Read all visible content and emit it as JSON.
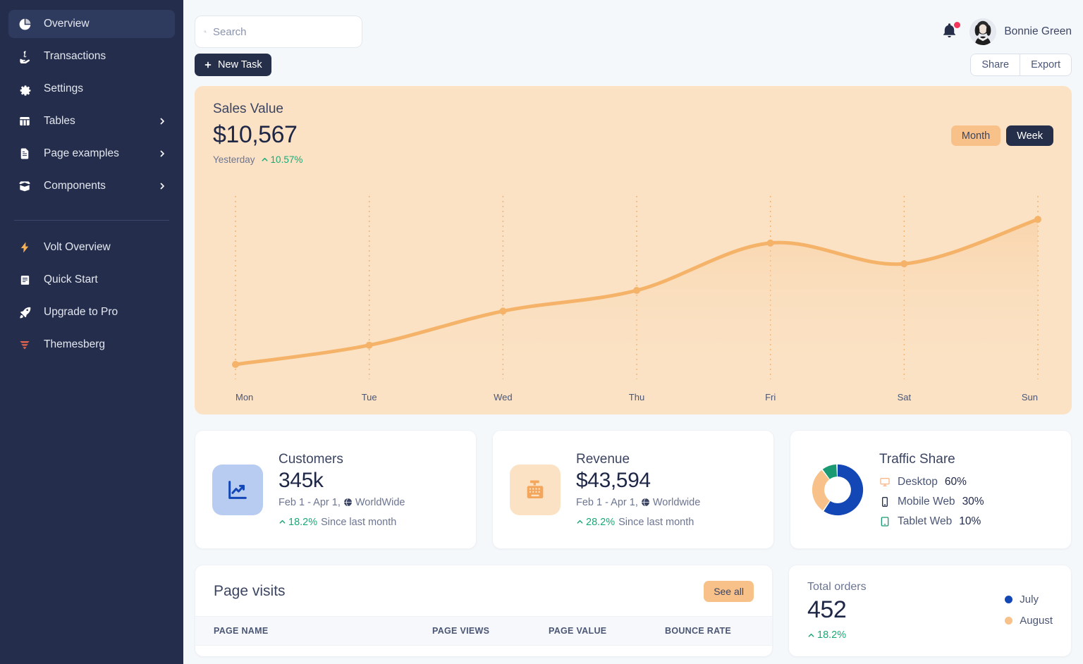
{
  "sidebar": {
    "items": [
      {
        "label": "Overview",
        "icon": "pie-chart-icon",
        "active": true,
        "chevron": false
      },
      {
        "label": "Transactions",
        "icon": "hand-dollar-icon",
        "active": false,
        "chevron": false
      },
      {
        "label": "Settings",
        "icon": "gear-icon",
        "active": false,
        "chevron": false
      },
      {
        "label": "Tables",
        "icon": "table-icon",
        "active": false,
        "chevron": true
      },
      {
        "label": "Page examples",
        "icon": "document-icon",
        "active": false,
        "chevron": true
      },
      {
        "label": "Components",
        "icon": "open-box-icon",
        "active": false,
        "chevron": true
      }
    ],
    "secondary": [
      {
        "label": "Volt Overview",
        "icon": "lightning-bolt-icon",
        "color": "#f8b155"
      },
      {
        "label": "Quick Start",
        "icon": "book-icon",
        "color": "#ffffff"
      },
      {
        "label": "Upgrade to Pro",
        "icon": "rocket-icon",
        "color": "#ffffff"
      },
      {
        "label": "Themesberg",
        "icon": "themesberg-logo-icon",
        "color": "#f0674f"
      }
    ]
  },
  "topbar": {
    "search_placeholder": "Search",
    "search_value": "",
    "notification_badge": true,
    "user_name": "Bonnie Green"
  },
  "actionbar": {
    "new_task_label": "New Task",
    "share_label": "Share",
    "export_label": "Export"
  },
  "sales": {
    "title": "Sales Value",
    "value": "$10,567",
    "period_label": "Yesterday",
    "change": "10.57%",
    "toggle_month": "Month",
    "toggle_week": "Week"
  },
  "chart_data": {
    "type": "line",
    "title": "Sales Value",
    "categories": [
      "Mon",
      "Tue",
      "Wed",
      "Thu",
      "Fri",
      "Sat",
      "Sun"
    ],
    "values": [
      10,
      23,
      46,
      60,
      92,
      78,
      108
    ],
    "xlabel": "",
    "ylabel": "",
    "ylim": [
      0,
      120
    ],
    "grid": "vertical-dotted",
    "legend": "none",
    "line_color": "#f5b36a",
    "fill_color": "#f9d6ab"
  },
  "stats": [
    {
      "name": "Customers",
      "value": "345k",
      "range": "Feb 1 - Apr 1,",
      "scope": "WorldWide",
      "delta": "18.2%",
      "delta_suffix": "Since last month",
      "icon": "chart-line-up-icon",
      "icon_style": "blue"
    },
    {
      "name": "Revenue",
      "value": "$43,594",
      "range": "Feb 1 - Apr 1,",
      "scope": "Worldwide",
      "delta": "28.2%",
      "delta_suffix": "Since last month",
      "icon": "cash-register-icon",
      "icon_style": "peach"
    }
  ],
  "traffic": {
    "title": "Traffic Share",
    "donut": {
      "type": "pie",
      "labels": [
        "Desktop",
        "Mobile Web",
        "Tablet Web"
      ],
      "values": [
        60,
        30,
        10
      ],
      "colors": [
        "#1347b5",
        "#f8c189",
        "#1a9a73"
      ]
    },
    "items": [
      {
        "label": "Desktop",
        "value": "60%",
        "icon": "desktop-icon",
        "color": "#f8b88a"
      },
      {
        "label": "Mobile Web",
        "value": "30%",
        "icon": "mobile-icon",
        "color": "#262f49"
      },
      {
        "label": "Tablet Web",
        "value": "10%",
        "icon": "tablet-icon",
        "color": "#1a9a73"
      }
    ]
  },
  "page_visits": {
    "title": "Page visits",
    "see_all_label": "See all",
    "columns": [
      "PAGE NAME",
      "PAGE VIEWS",
      "PAGE VALUE",
      "BOUNCE RATE"
    ]
  },
  "total_orders": {
    "label": "Total orders",
    "value": "452",
    "delta": "18.2%",
    "legend": [
      {
        "label": "July",
        "color": "#1347b5"
      },
      {
        "label": "August",
        "color": "#f8c189"
      }
    ]
  }
}
